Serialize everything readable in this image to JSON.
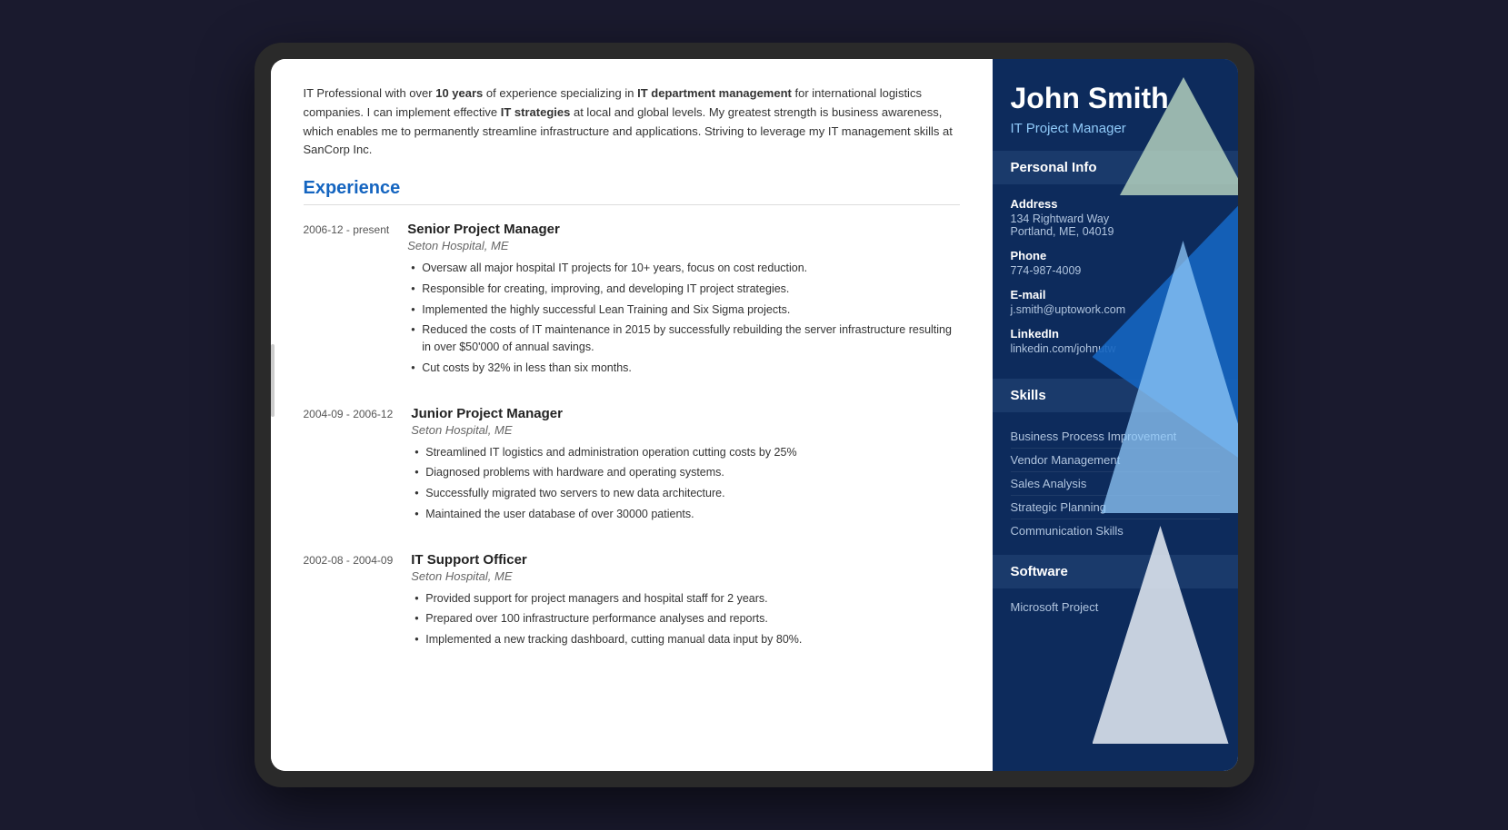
{
  "person": {
    "name": "John Smith",
    "job_title": "IT Project Manager"
  },
  "summary": {
    "text_parts": [
      {
        "text": "IT Professional with over ",
        "bold": false
      },
      {
        "text": "10 years",
        "bold": true
      },
      {
        "text": " of experience specializing in ",
        "bold": false
      },
      {
        "text": "IT department management",
        "bold": true
      },
      {
        "text": " for international logistics companies. I can implement effective ",
        "bold": false
      },
      {
        "text": "IT strategies",
        "bold": true
      },
      {
        "text": " at local and global levels. My greatest strength is business awareness, which enables me to permanently streamline infrastructure and applications. Striving to leverage my IT management skills at SanCorp Inc.",
        "bold": false
      }
    ]
  },
  "sections": {
    "experience_label": "Experience",
    "personal_info_label": "Personal Info",
    "skills_label": "Skills",
    "software_label": "Software"
  },
  "contact": {
    "address_label": "Address",
    "address_line1": "134 Rightward Way",
    "address_line2": "Portland, ME, 04019",
    "phone_label": "Phone",
    "phone": "774-987-4009",
    "email_label": "E-mail",
    "email": "j.smith@uptowork.com",
    "linkedin_label": "LinkedIn",
    "linkedin": "linkedin.com/johnutw"
  },
  "skills": [
    "Business Process Improvement",
    "Vendor Management",
    "Sales Analysis",
    "Strategic Planning",
    "Communication Skills"
  ],
  "software": [
    "Microsoft Project"
  ],
  "experience": [
    {
      "date": "2006-12 - present",
      "title": "Senior Project Manager",
      "company": "Seton Hospital, ME",
      "bullets": [
        "Oversaw all major hospital IT projects for 10+ years, focus on cost reduction.",
        "Responsible for creating, improving, and developing IT project strategies.",
        "Implemented the highly successful Lean Training and Six Sigma projects.",
        "Reduced the costs of IT maintenance in 2015 by successfully rebuilding the server infrastructure resulting in over $50'000 of annual savings.",
        "Cut costs by 32% in less than six months."
      ]
    },
    {
      "date": "2004-09 - 2006-12",
      "title": "Junior Project Manager",
      "company": "Seton Hospital, ME",
      "bullets": [
        "Streamlined IT logistics and administration operation cutting costs by 25%",
        "Diagnosed problems with hardware and operating systems.",
        "Successfully migrated two servers to new data architecture.",
        "Maintained the user database of over 30000 patients."
      ]
    },
    {
      "date": "2002-08 - 2004-09",
      "title": "IT Support Officer",
      "company": "Seton Hospital, ME",
      "bullets": [
        "Provided support for project managers and hospital staff for 2 years.",
        "Prepared over 100 infrastructure performance analyses and reports.",
        "Implemented a new tracking dashboard, cutting manual data input by 80%."
      ]
    }
  ]
}
